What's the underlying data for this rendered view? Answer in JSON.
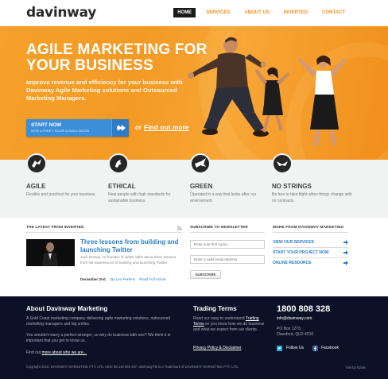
{
  "header": {
    "logo": "davinway",
    "nav": [
      "HOME",
      "SERVICES",
      "ABOUT US",
      "INVERTED",
      "CONTACT"
    ]
  },
  "hero": {
    "title_line1": "AGILE MARKETING FOR",
    "title_line2": "YOUR BUSINESS",
    "text": "Improve revenue and efficiency for your business with Davinway Agile Marketing solutions and Outsourced Marketing Managers.",
    "cta_main": "START NOW",
    "cta_sub": "WITH A FREE 1 HOUR CONSULTATION",
    "or": "or",
    "find_out": "Find out more"
  },
  "features": [
    {
      "title": "AGILE",
      "desc": "Flexible and practical for your business."
    },
    {
      "title": "ETHICAL",
      "desc": "Real people with high standards for sustainable business."
    },
    {
      "title": "GREEN",
      "desc": "Operated in a way that looks after our environment."
    },
    {
      "title": "NO STRINGS",
      "desc": "Be free to take flight when things change with no contracts."
    }
  ],
  "latest": {
    "heading": "THE LATEST FROM INVERTED",
    "post_title": "Three lessons from building and launching Twitter",
    "post_body": "Jack Dorsey, co-founder of twitter talks about three lessons from his experiences of building and launching Twitter.",
    "date": "December 2nd",
    "by": "By Leo Perkins",
    "read": "Read Full Article"
  },
  "newsletter": {
    "heading": "SUBSCRIBE TO NEWSLETTER",
    "first_name_placeholder": "Enter your first name ..",
    "email_placeholder": "Enter a valid email address..",
    "button": "SUBSCRIBE"
  },
  "more": {
    "heading": "MORE FROM DAVINWAY MARKETING",
    "links": [
      "VIEW OUR SERVICES",
      "START YOUR PROJECT NOW",
      "ONLINE RESOURCE"
    ]
  },
  "footer": {
    "about_heading": "About Davinway Marketing",
    "about_p1": "A Gold Coast marketing company delivering agile marketing solutions, outsourced marketing managers and big smiles.",
    "about_p2": "You wouldn't marry a perfect stranger, so why do business with one? We think it is important that you get to know us.",
    "find_out_prefix": "Find out",
    "find_out_link": "more about who we are...",
    "trading_heading": "Trading Terms",
    "trading_text_1": "Read our easy to understand",
    "trading_link": "Trading Terms",
    "trading_text_2": "so you know how we do business and what we expect from our clients.",
    "privacy": "Privacy Policy & Disclaimer",
    "phone": "1800 808 328",
    "email": "info@davinway.com",
    "po_box": "PO Box 1273,",
    "city": "Oxenford, QLD 4210",
    "follow": "Follow Us",
    "facebook": "Facebook",
    "copyright": "Copyright 2010. DAVINWAY MARKETING PTY. LTD. ABN: 85 142 605 497. davinwayTM is a Trademark of DAVINWAY MARKETING PTY. LTD.",
    "site_by": "Site by 51bits"
  },
  "colors": {
    "orange": "#f39a24",
    "blue_cta": "#3b8fd9",
    "link_blue": "#2a7fcc",
    "footer_bg": "#0b1227"
  }
}
